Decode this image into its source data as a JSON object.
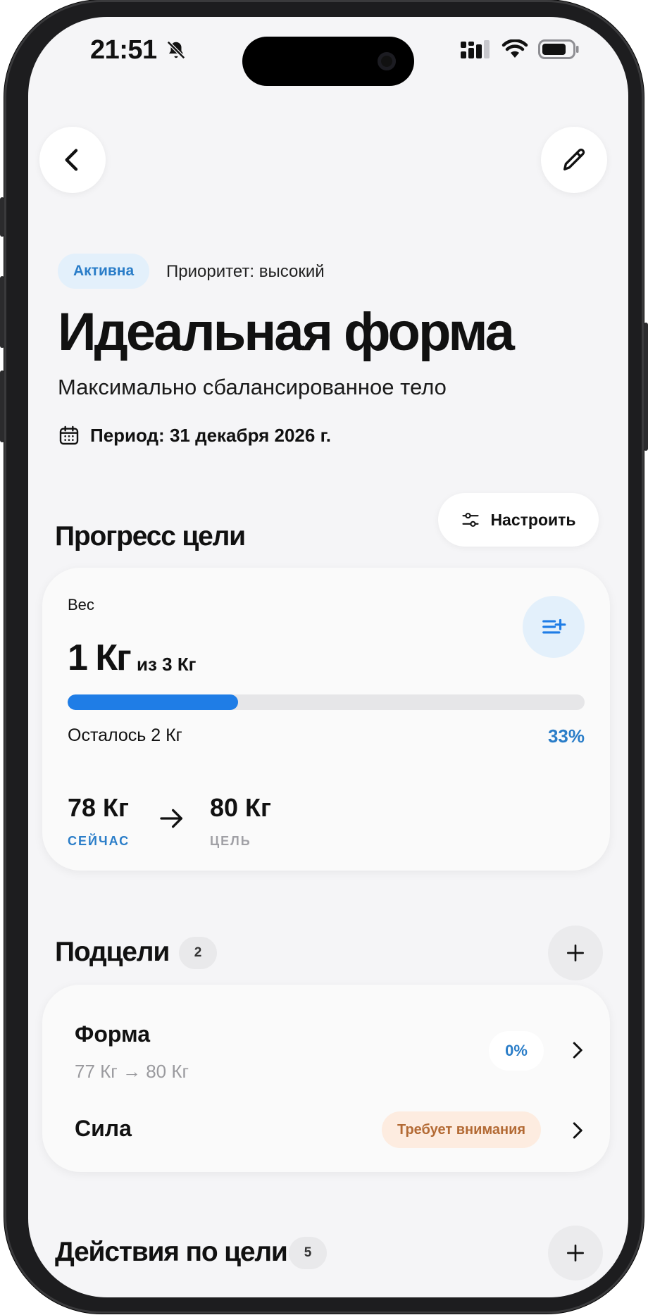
{
  "status_bar": {
    "time": "21:51"
  },
  "goal": {
    "status": "Активна",
    "priority": "Приоритет: высокий",
    "title": "Идеальная форма",
    "subtitle": "Максимально сбалансированное тело",
    "period": "Период: 31 декабря 2026 г."
  },
  "progress_section": {
    "title": "Прогресс цели",
    "configure_label": "Настроить",
    "metric_label": "Вес",
    "current_progress": "1 Кг",
    "target_progress": "из 3 Кг",
    "remaining": "Осталось 2 Кг",
    "percent_text": "33%",
    "percent_value": 33,
    "start_value": "78 Кг",
    "start_caption": "СЕЙЧАС",
    "goal_value": "80 Кг",
    "goal_caption": "ЦЕЛЬ"
  },
  "subgoals_section": {
    "title": "Подцели",
    "count": "2",
    "items": [
      {
        "name": "Форма",
        "range": "77 Кг → 80 Кг",
        "badge": "0%"
      },
      {
        "name": "Сила",
        "badge": "Требует внимания"
      }
    ]
  },
  "actions_section": {
    "title": "Действия по цели",
    "count": "5"
  },
  "colors": {
    "accent": "#1f7de6",
    "accent_text": "#2a7dc8",
    "warning_bg": "#fdece0",
    "warning_text": "#b36a34"
  },
  "icons": [
    "back-icon",
    "edit-icon",
    "calendar-icon",
    "sliders-icon",
    "add-entry-icon",
    "arrow-right-icon",
    "plus-icon",
    "chevron-right-icon"
  ]
}
